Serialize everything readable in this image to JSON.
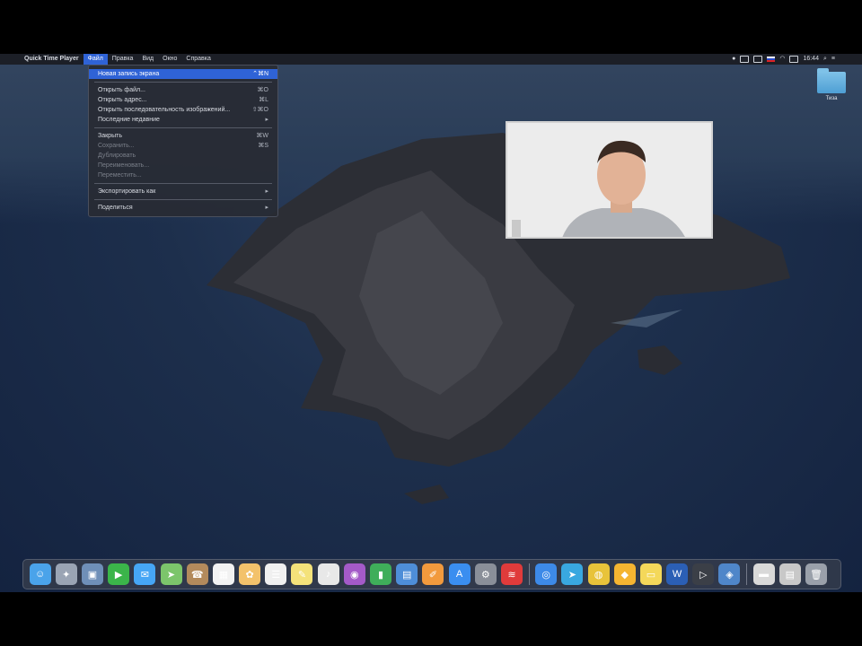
{
  "menubar": {
    "app_name": "Quick Time Player",
    "items": [
      "Файл",
      "Правка",
      "Вид",
      "Окно",
      "Справка"
    ],
    "active_index": 0,
    "clock": "16:44"
  },
  "file_menu": {
    "items": [
      {
        "label": "Новая запись экрана",
        "shortcut": "⌃⌘N",
        "highlighted": true
      },
      {
        "sep": true
      },
      {
        "label": "Открыть файл...",
        "shortcut": "⌘O"
      },
      {
        "label": "Открыть адрес...",
        "shortcut": "⌘L"
      },
      {
        "label": "Открыть последовательность изображений...",
        "shortcut": "⇧⌘O"
      },
      {
        "label": "Последние недавние",
        "shortcut": "▸"
      },
      {
        "sep": true
      },
      {
        "label": "Закрыть",
        "shortcut": "⌘W"
      },
      {
        "label": "Сохранить...",
        "shortcut": "⌘S",
        "dim": true
      },
      {
        "label": "Дублировать",
        "shortcut": "",
        "dim": true
      },
      {
        "label": "Переименовать...",
        "shortcut": "",
        "dim": true
      },
      {
        "label": "Переместить...",
        "shortcut": "",
        "dim": true
      },
      {
        "sep": true
      },
      {
        "label": "Экспортировать как",
        "shortcut": "▸"
      },
      {
        "sep": true
      },
      {
        "label": "Поделиться",
        "shortcut": "▸"
      }
    ]
  },
  "desktop": {
    "folder_label": "Тиза"
  },
  "colors": {
    "accent": "#2f63d6",
    "menu_bg": "#282b34",
    "desktop_sea": "#1d2f4c"
  },
  "dock": {
    "apps": [
      {
        "name": "finder-icon",
        "glyph": "☺",
        "bg": "#4aa3ea"
      },
      {
        "name": "launchpad-icon",
        "glyph": "✦",
        "bg": "#9aa4b4"
      },
      {
        "name": "preview-icon",
        "glyph": "▣",
        "bg": "#6f8fb8"
      },
      {
        "name": "facetime-icon",
        "glyph": "▶",
        "bg": "#3bb54a"
      },
      {
        "name": "messages-icon",
        "glyph": "✉",
        "bg": "#46a6f5"
      },
      {
        "name": "maps-icon",
        "glyph": "➤",
        "bg": "#7cc56b"
      },
      {
        "name": "contacts-icon",
        "glyph": "☎",
        "bg": "#b38a5c"
      },
      {
        "name": "calendar-icon",
        "glyph": "▦",
        "bg": "#f2f2f2"
      },
      {
        "name": "photos-icon",
        "glyph": "✿",
        "bg": "#f3c26b"
      },
      {
        "name": "reminders-icon",
        "glyph": "☰",
        "bg": "#f0f0f0"
      },
      {
        "name": "notes-icon",
        "glyph": "✎",
        "bg": "#f4e27a"
      },
      {
        "name": "music-icon",
        "glyph": "♪",
        "bg": "#e8e8e8"
      },
      {
        "name": "podcasts-icon",
        "glyph": "◉",
        "bg": "#a45ac8"
      },
      {
        "name": "numbers-icon",
        "glyph": "▮",
        "bg": "#3fae5a"
      },
      {
        "name": "keynote-icon",
        "glyph": "▤",
        "bg": "#4e8ed8"
      },
      {
        "name": "pages-icon",
        "glyph": "✐",
        "bg": "#f29a3d"
      },
      {
        "name": "app-store-icon",
        "glyph": "A",
        "bg": "#3a8ef0"
      },
      {
        "name": "system-preferences-icon",
        "glyph": "⚙",
        "bg": "#8a8f99"
      },
      {
        "name": "flags-icon",
        "glyph": "≋",
        "bg": "#e03b3b"
      }
    ],
    "apps2": [
      {
        "name": "safari-icon",
        "glyph": "◎",
        "bg": "#3d8ae8"
      },
      {
        "name": "telegram-icon",
        "glyph": "➤",
        "bg": "#39a8e0"
      },
      {
        "name": "chrome-icon",
        "glyph": "◍",
        "bg": "#e8c33a"
      },
      {
        "name": "sketch-icon",
        "glyph": "◆",
        "bg": "#f5b531"
      },
      {
        "name": "stickies-icon",
        "glyph": "▭",
        "bg": "#f4d85a"
      },
      {
        "name": "word-icon",
        "glyph": "W",
        "bg": "#2b5fb5"
      },
      {
        "name": "quicktime-icon",
        "glyph": "▷",
        "bg": "#3b3f47"
      },
      {
        "name": "network-icon",
        "glyph": "◈",
        "bg": "#4f86c9"
      }
    ],
    "apps3": [
      {
        "name": "downloads-icon",
        "glyph": "▬",
        "bg": "#d9d9d9"
      },
      {
        "name": "documents-icon",
        "glyph": "▤",
        "bg": "#c8c8c8"
      },
      {
        "name": "trash-icon",
        "glyph": "🗑",
        "bg": "#9aa0aa"
      }
    ]
  }
}
